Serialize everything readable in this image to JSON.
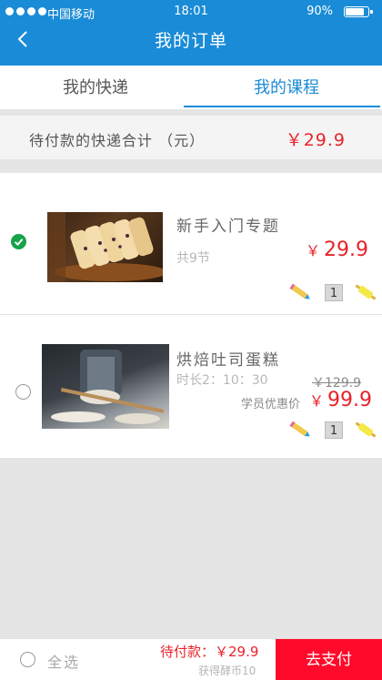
{
  "status_bar": {
    "carrier": "中国移动",
    "time": "18:01",
    "battery": "90%",
    "battery_level": 0.9
  },
  "header": {
    "title": "我的订单",
    "back_icon": "back-chevron-icon"
  },
  "tabs": [
    {
      "label": "我的快递",
      "active": false
    },
    {
      "label": "我的课程",
      "active": true
    }
  ],
  "summary": {
    "label": "待付款的快递合计 （元）",
    "value": "￥29.9"
  },
  "orders": [
    {
      "selected": true,
      "title": "新手入门专题",
      "subtitle": "共9节",
      "currency": "￥",
      "price": "29.9",
      "quantity": "1",
      "tools": [
        "pencil-icon",
        "rolling-pin-icon"
      ]
    },
    {
      "selected": false,
      "title": "烘焙吐司蛋糕",
      "subtitle": "时长2：10：30",
      "original_price": "￥129.9",
      "member_label": "学员优惠价",
      "currency": "￥",
      "price": "99.9",
      "quantity": "1",
      "tools": [
        "pencil-icon",
        "rolling-pin-icon"
      ]
    }
  ],
  "footer": {
    "select_all": "全选",
    "total": "待付款：￥29.9",
    "coins": "获得酵币10",
    "pay_button": "去支付"
  },
  "colors": {
    "brand_blue": "#1a8bd6",
    "price_red": "#e8222b",
    "pay_red": "#ff0a2a",
    "check_green": "#16a34a"
  }
}
